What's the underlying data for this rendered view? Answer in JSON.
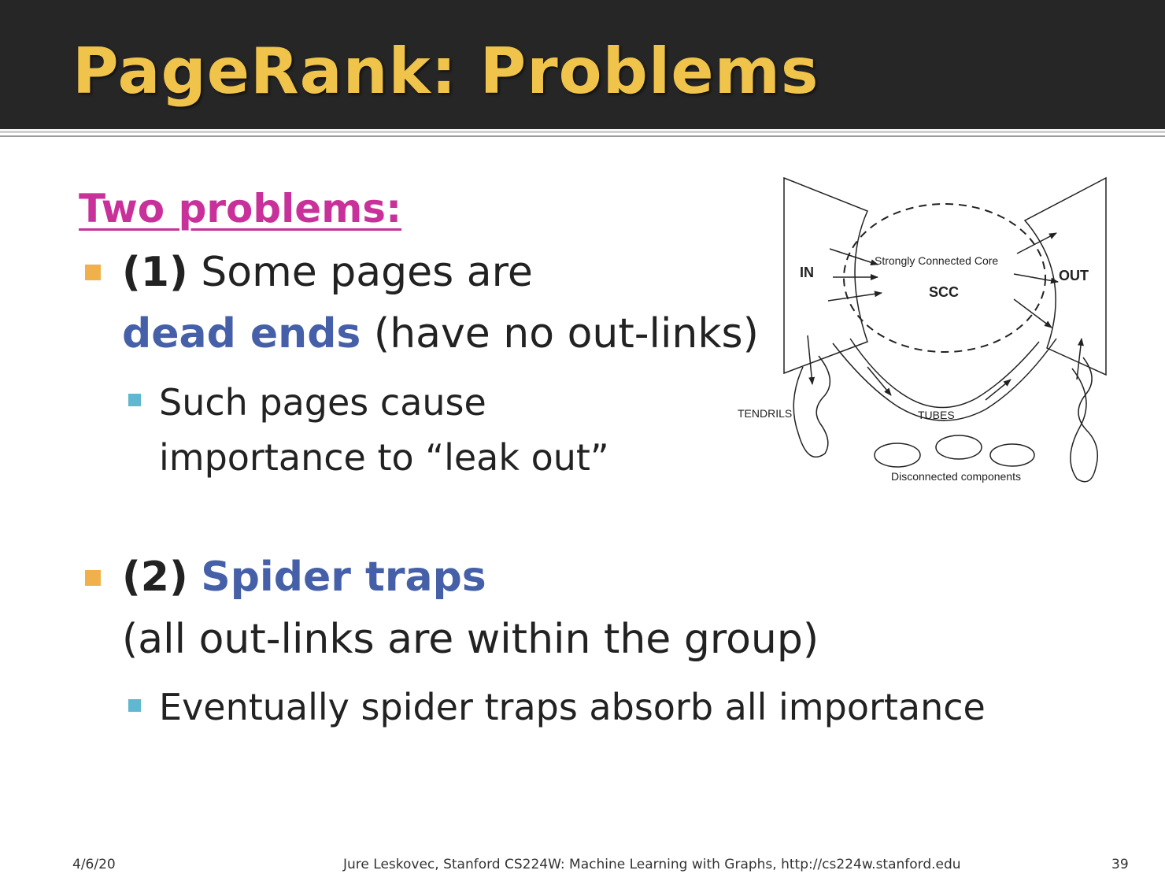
{
  "slide": {
    "title": "PageRank: Problems",
    "heading": "Two problems:",
    "bullet1": {
      "prefix": "(1)",
      "text_a": " Some pages are",
      "highlight": "dead ends",
      "text_b": " (have no out-links)",
      "sub_line1": "Such pages cause",
      "sub_line2": "importance to “leak out”"
    },
    "bullet2": {
      "prefix": "(2)",
      "highlight": "Spider traps",
      "line2": "(all out-links are within the group)",
      "sub_line1": "Eventually spider traps absorb all importance"
    }
  },
  "diagram": {
    "labels": {
      "in": "IN",
      "out": "OUT",
      "core": "Strongly Connected Core",
      "scc": "SCC",
      "tendrils": "TENDRILS",
      "tubes": "TUBES",
      "disconnected": "Disconnected components"
    }
  },
  "footer": {
    "date": "4/6/20",
    "credit": "Jure Leskovec, Stanford CS224W: Machine Learning with Graphs, http://cs224w.stanford.edu",
    "page": "39"
  },
  "colors": {
    "title_bar": "#262626",
    "title_text": "#f0c34a",
    "heading": "#c9319a",
    "highlight": "#4560a8",
    "bullet": "#f0b14c",
    "sub_bullet": "#5fb7d0"
  }
}
